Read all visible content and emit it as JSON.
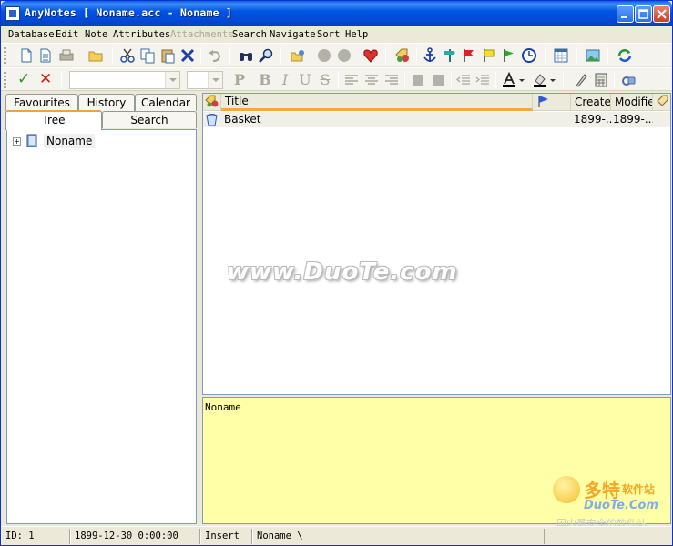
{
  "window": {
    "title": "AnyNotes [ Noname.acc - Noname ]",
    "controls": [
      "minimize",
      "maximize",
      "close"
    ]
  },
  "menu": [
    {
      "label": "Database",
      "enabled": true
    },
    {
      "label": "Edit",
      "enabled": true
    },
    {
      "label": "Note",
      "enabled": true
    },
    {
      "label": "Attributes",
      "enabled": true
    },
    {
      "label": "Attachments",
      "enabled": false
    },
    {
      "label": "Search",
      "enabled": true
    },
    {
      "label": "Navigate",
      "enabled": true
    },
    {
      "label": "Sort",
      "enabled": true
    },
    {
      "label": "Help",
      "enabled": true
    }
  ],
  "toolbar1": {
    "icons": [
      "new-note-icon",
      "new-document-icon",
      "print-icon",
      "open-folder-icon",
      "cut-icon",
      "copy-icon",
      "paste-icon",
      "delete-icon",
      "undo-icon",
      "find-binoculars-icon",
      "find-magnifier-icon",
      "open-folders-icon",
      "circle-gray-icon",
      "circle-gray-icon",
      "heart-icon",
      "tags-icon",
      "anchor-icon",
      "signpost-icon",
      "red-flag-icon",
      "yellow-flag-icon",
      "green-flag-icon",
      "clock-icon",
      "calendar-grid-icon",
      "picture-icon",
      "refresh-icon"
    ]
  },
  "toolbar2": {
    "accept_symbol": "✓",
    "cancel_symbol": "✕",
    "font_name_value": "",
    "font_size_value": "",
    "format_buttons": [
      "P",
      "B",
      "I",
      "U",
      "S"
    ]
  },
  "tabs": {
    "row1": [
      "Favourites",
      "History",
      "Calendar"
    ],
    "row2": [
      "Tree",
      "Search"
    ],
    "active": "Tree"
  },
  "tree": {
    "nodes": [
      {
        "label": "Noname",
        "expander": "+"
      }
    ]
  },
  "list": {
    "columns": [
      "Title",
      "Created",
      "Modified"
    ],
    "rows": [
      {
        "title": "Basket",
        "created": "1899-...",
        "modified": "1899-..."
      }
    ]
  },
  "note": {
    "text": "Noname"
  },
  "statusbar": {
    "id": "ID: 1",
    "datetime": "1899-12-30 0:00:00",
    "mode": "Insert",
    "path": "Noname \\"
  },
  "watermark": {
    "text": "www.DuoTe.com",
    "brand": "多特",
    "brand_small": "软件站",
    "site": "DuoTe.Com",
    "slogan": "国内最安全的软件站"
  },
  "colors": {
    "titlebar": "#0055e5",
    "note_background": "#ffffa8",
    "tab_active_accent": "#f1a04a"
  }
}
